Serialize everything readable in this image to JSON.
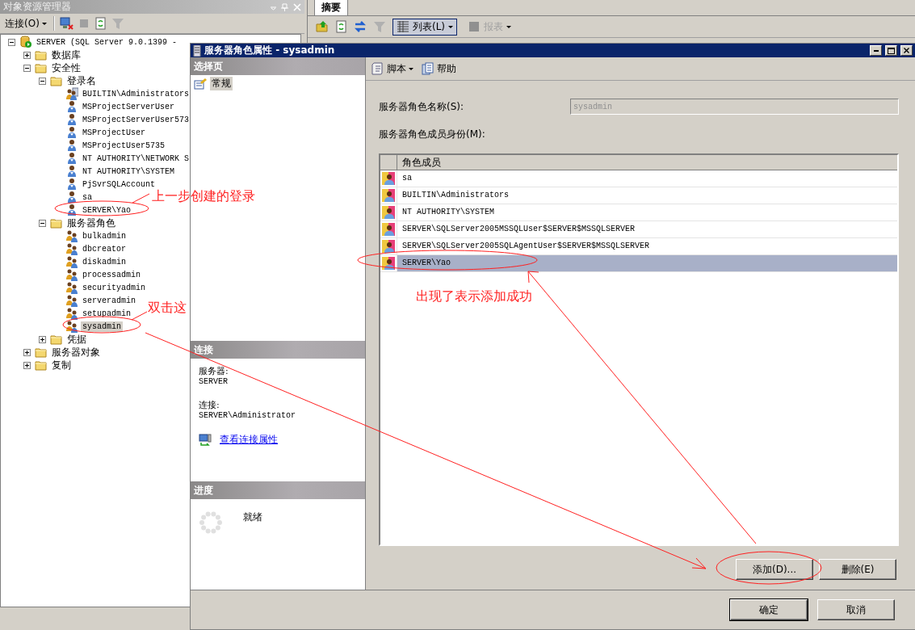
{
  "explorer": {
    "title": "对象资源管理器",
    "connect_label": "连接(O)",
    "tree": [
      {
        "label": "SERVER (SQL Server 9.0.1399 -",
        "kind": "server",
        "selected": false,
        "expanded": true,
        "children": [
          {
            "label": "数据库",
            "kind": "folder",
            "selected": false,
            "expanded": false
          },
          {
            "label": "安全性",
            "kind": "folder",
            "selected": false,
            "expanded": true,
            "children": [
              {
                "label": "登录名",
                "kind": "folder",
                "selected": false,
                "expanded": true,
                "children": [
                  {
                    "label": "BUILTIN\\Administrators",
                    "kind": "group",
                    "selected": false
                  },
                  {
                    "label": "MSProjectServerUser",
                    "kind": "login",
                    "selected": false
                  },
                  {
                    "label": "MSProjectServerUser573",
                    "kind": "login",
                    "selected": false
                  },
                  {
                    "label": "MSProjectUser",
                    "kind": "login",
                    "selected": false
                  },
                  {
                    "label": "MSProjectUser5735",
                    "kind": "login",
                    "selected": false
                  },
                  {
                    "label": "NT AUTHORITY\\NETWORK S",
                    "kind": "login",
                    "selected": false
                  },
                  {
                    "label": "NT AUTHORITY\\SYSTEM",
                    "kind": "login",
                    "selected": false
                  },
                  {
                    "label": "PjSvrSQLAccount",
                    "kind": "login",
                    "selected": false
                  },
                  {
                    "label": "sa",
                    "kind": "login",
                    "selected": false
                  },
                  {
                    "label": "SERVER\\Yao",
                    "kind": "login",
                    "selected": false
                  }
                ]
              },
              {
                "label": "服务器角色",
                "kind": "folder",
                "selected": false,
                "expanded": true,
                "children": [
                  {
                    "label": "bulkadmin",
                    "kind": "role",
                    "selected": false
                  },
                  {
                    "label": "dbcreator",
                    "kind": "role",
                    "selected": false
                  },
                  {
                    "label": "diskadmin",
                    "kind": "role",
                    "selected": false
                  },
                  {
                    "label": "processadmin",
                    "kind": "role",
                    "selected": false
                  },
                  {
                    "label": "securityadmin",
                    "kind": "role",
                    "selected": false
                  },
                  {
                    "label": "serveradmin",
                    "kind": "role",
                    "selected": false
                  },
                  {
                    "label": "setupadmin",
                    "kind": "role",
                    "selected": false
                  },
                  {
                    "label": "sysadmin",
                    "kind": "role",
                    "selected": true
                  }
                ]
              },
              {
                "label": "凭据",
                "kind": "folder",
                "selected": false,
                "expanded": false
              }
            ]
          },
          {
            "label": "服务器对象",
            "kind": "folder",
            "selected": false,
            "expanded": false
          },
          {
            "label": "复制",
            "kind": "folder",
            "selected": false,
            "expanded": false
          }
        ]
      }
    ]
  },
  "summary": {
    "tab": "摘要",
    "views": [
      {
        "label": "列表(L)",
        "disabled": false
      },
      {
        "label": "报表",
        "disabled": true
      }
    ]
  },
  "dialog": {
    "title": "服务器角色属性 - sysadmin",
    "select_page_header": "选择页",
    "pages": [
      {
        "label": "常规",
        "selected": true
      }
    ],
    "toolbar": {
      "script": "脚本",
      "help": "帮助"
    },
    "name_label": "服务器角色名称(S):",
    "name_value": "sysadmin",
    "members_label": "服务器角色成员身份(M):",
    "members_column": "角色成员",
    "members": [
      {
        "name": "sa",
        "selected": false
      },
      {
        "name": "BUILTIN\\Administrators",
        "selected": false
      },
      {
        "name": "NT AUTHORITY\\SYSTEM",
        "selected": false
      },
      {
        "name": "SERVER\\SQLServer2005MSSQLUser$SERVER$MSSQLSERVER",
        "selected": false
      },
      {
        "name": "SERVER\\SQLServer2005SQLAgentUser$SERVER$MSSQLSERVER",
        "selected": false
      },
      {
        "name": "SERVER\\Yao",
        "selected": true
      }
    ],
    "add_button": "添加(D)...",
    "remove_button": "删除(E)",
    "connection_header": "连接",
    "server_label": "服务器:",
    "server_value": "SERVER",
    "connection_label": "连接:",
    "connection_value": "SERVER\\Administrator",
    "connection_link": "查看连接属性",
    "progress_header": "进度",
    "progress_status": "就绪",
    "ok_button": "确定",
    "cancel_button": "取消"
  },
  "annotations": [
    {
      "text": "上一步创建的登录"
    },
    {
      "text": "双击这"
    },
    {
      "text": "出现了表示添加成功"
    }
  ]
}
